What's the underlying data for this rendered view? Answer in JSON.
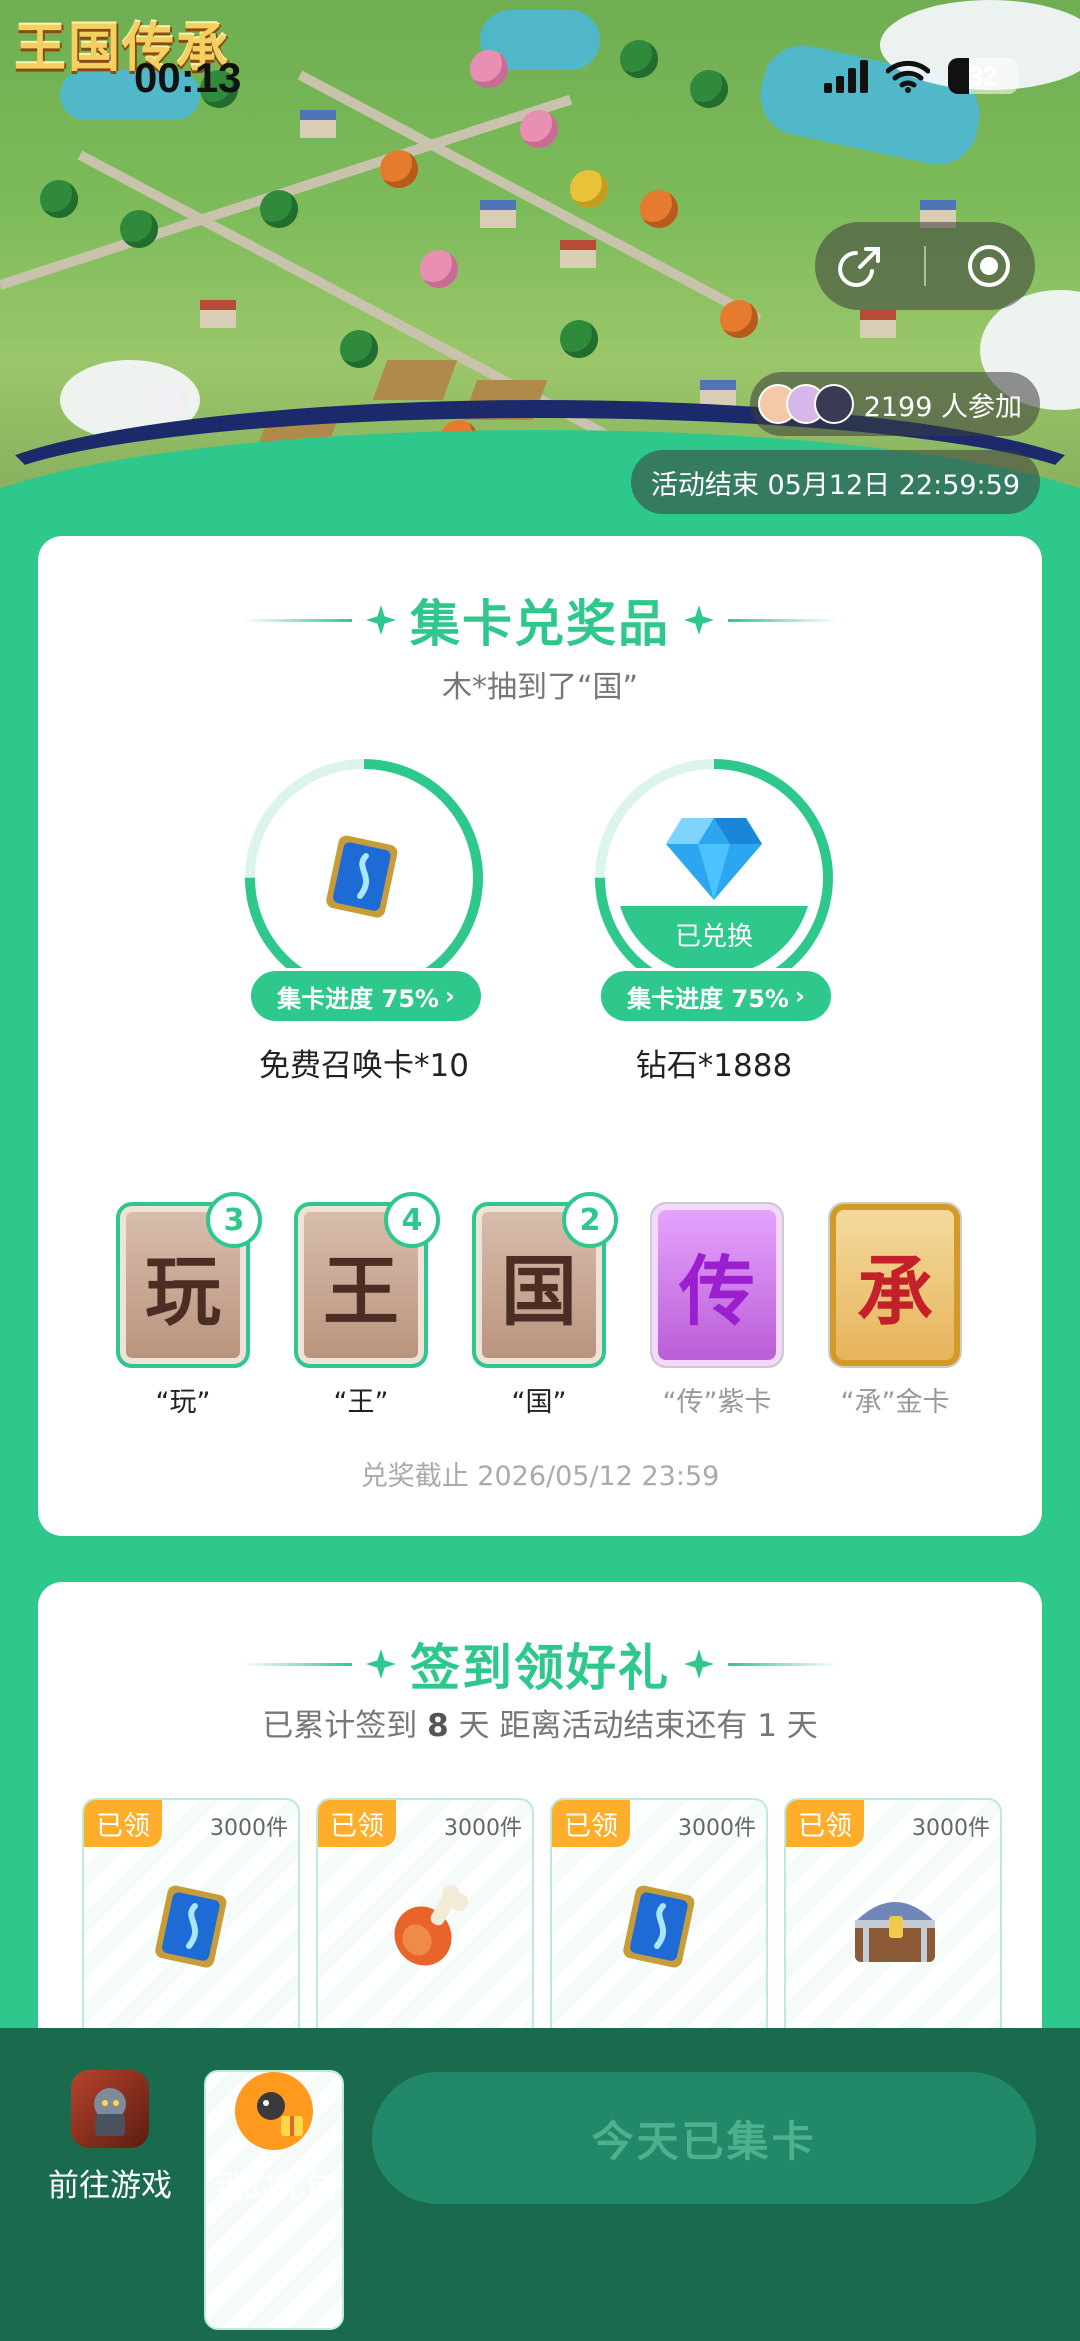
{
  "status_bar": {
    "time": "00:13",
    "battery": "32"
  },
  "hero": {
    "game_logo": "王国传承",
    "participants_text": "2199 人参加",
    "end_time": "活动结束 05月12日 22:59:59"
  },
  "collect": {
    "title": "集卡兑奖品",
    "ticker": "木*抽到了“国”",
    "prizes": [
      {
        "name": "免费召唤卡*10",
        "progress_label": "集卡进度 75%",
        "progress": 0.75,
        "redeemed": false
      },
      {
        "name": "钻石*1888",
        "progress_label": "集卡进度 75%",
        "progress": 0.75,
        "redeemed": true,
        "redeemed_label": "已兑换"
      }
    ],
    "letters": [
      {
        "char": "玩",
        "label": "“玩”",
        "count": "3",
        "style": "owned"
      },
      {
        "char": "王",
        "label": "“王”",
        "count": "4",
        "style": "owned"
      },
      {
        "char": "国",
        "label": "“国”",
        "count": "2",
        "style": "owned"
      },
      {
        "char": "传",
        "label": "“传”紫卡",
        "count": "",
        "style": "purple"
      },
      {
        "char": "承",
        "label": "“承”金卡",
        "count": "",
        "style": "gold"
      }
    ],
    "deadline": "兑奖截止 2026/05/12 23:59"
  },
  "signin": {
    "title": "签到领好礼",
    "sub_prefix": "已累计签到",
    "days": "8",
    "sub_suffix": "天  距离活动结束还有 1 天",
    "gifts": [
      {
        "tag": "已领",
        "qty": "3000件",
        "icon": "summon-card-icon"
      },
      {
        "tag": "已领",
        "qty": "3000件",
        "icon": "meat-icon"
      },
      {
        "tag": "已领",
        "qty": "3000件",
        "icon": "summon-card-icon"
      },
      {
        "tag": "已领",
        "qty": "3000件",
        "icon": "treasure-chest-icon"
      }
    ]
  },
  "bottom_bar": {
    "go_game": "前往游戏",
    "my_gifts": "我的礼包",
    "cta": "今天已集卡"
  },
  "colors": {
    "accent": "#2ec78c",
    "bottom_bar": "#1a6b4d",
    "tag": "#ffae2b"
  }
}
